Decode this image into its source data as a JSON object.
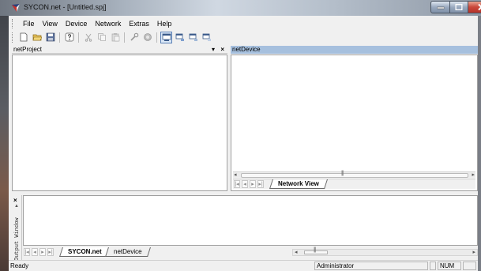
{
  "window": {
    "title": "SYCON.net - [Untitled.spj]"
  },
  "menu": [
    "File",
    "View",
    "Device",
    "Network",
    "Extras",
    "Help"
  ],
  "toolbar": {
    "buttons": [
      {
        "name": "new-file-icon"
      },
      {
        "name": "open-folder-icon"
      },
      {
        "name": "save-icon"
      },
      {
        "name": "help-icon"
      },
      {
        "name": "cut-icon"
      },
      {
        "name": "copy-icon"
      },
      {
        "name": "paste-icon"
      },
      {
        "name": "tools-icon"
      },
      {
        "name": "bus-icon"
      },
      {
        "name": "view-icon-1"
      },
      {
        "name": "view-icon-2"
      },
      {
        "name": "view-icon-3"
      },
      {
        "name": "view-icon-4"
      }
    ]
  },
  "panes": {
    "project": {
      "title": "netProject",
      "pin": "▾",
      "close": "×"
    },
    "device": {
      "title": "netDevice",
      "tab": "Network View",
      "scroll_marks": "|||"
    }
  },
  "output": {
    "close": "×",
    "pin": "▲",
    "label": "Output Window",
    "tabs": [
      "SYCON.net",
      "netDevice"
    ],
    "scroll_marks": "|||"
  },
  "status": {
    "text": "Ready",
    "user": "Administrator",
    "num": "NUM"
  },
  "colors": {
    "device_header": "#a6c0de",
    "close_button": "#c9473a"
  }
}
